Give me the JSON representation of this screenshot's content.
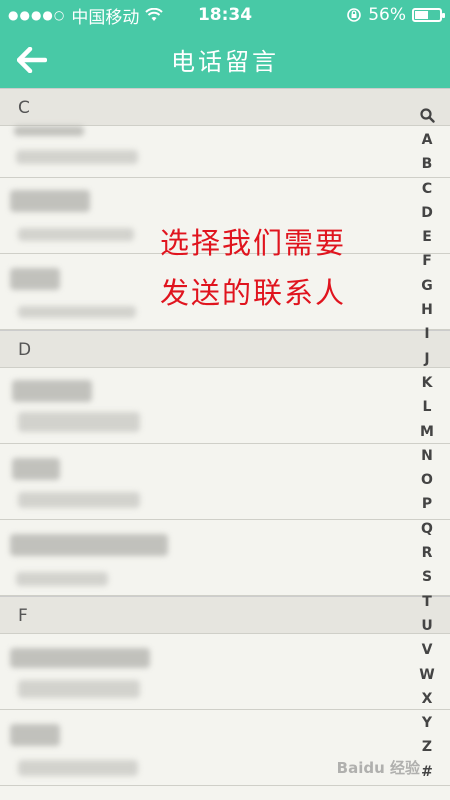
{
  "status_bar": {
    "carrier": "中国移动",
    "time": "18:34",
    "battery_percent": "56%",
    "battery_level": 0.56
  },
  "nav": {
    "title": "电话留言",
    "back_icon": "arrow-left-icon"
  },
  "sections": [
    {
      "letter": "C"
    },
    {
      "letter": "D"
    },
    {
      "letter": "F"
    }
  ],
  "index_letters": [
    "A",
    "B",
    "C",
    "D",
    "E",
    "F",
    "G",
    "H",
    "I",
    "J",
    "K",
    "L",
    "M",
    "N",
    "O",
    "P",
    "Q",
    "R",
    "S",
    "T",
    "U",
    "V",
    "W",
    "X",
    "Y",
    "Z",
    "#"
  ],
  "annotation": {
    "line1": "选择我们需要",
    "line2": "发送的联系人"
  },
  "watermark": "Baidu 经验",
  "colors": {
    "accent": "#48c9a6",
    "annotation": "#e0141e"
  }
}
